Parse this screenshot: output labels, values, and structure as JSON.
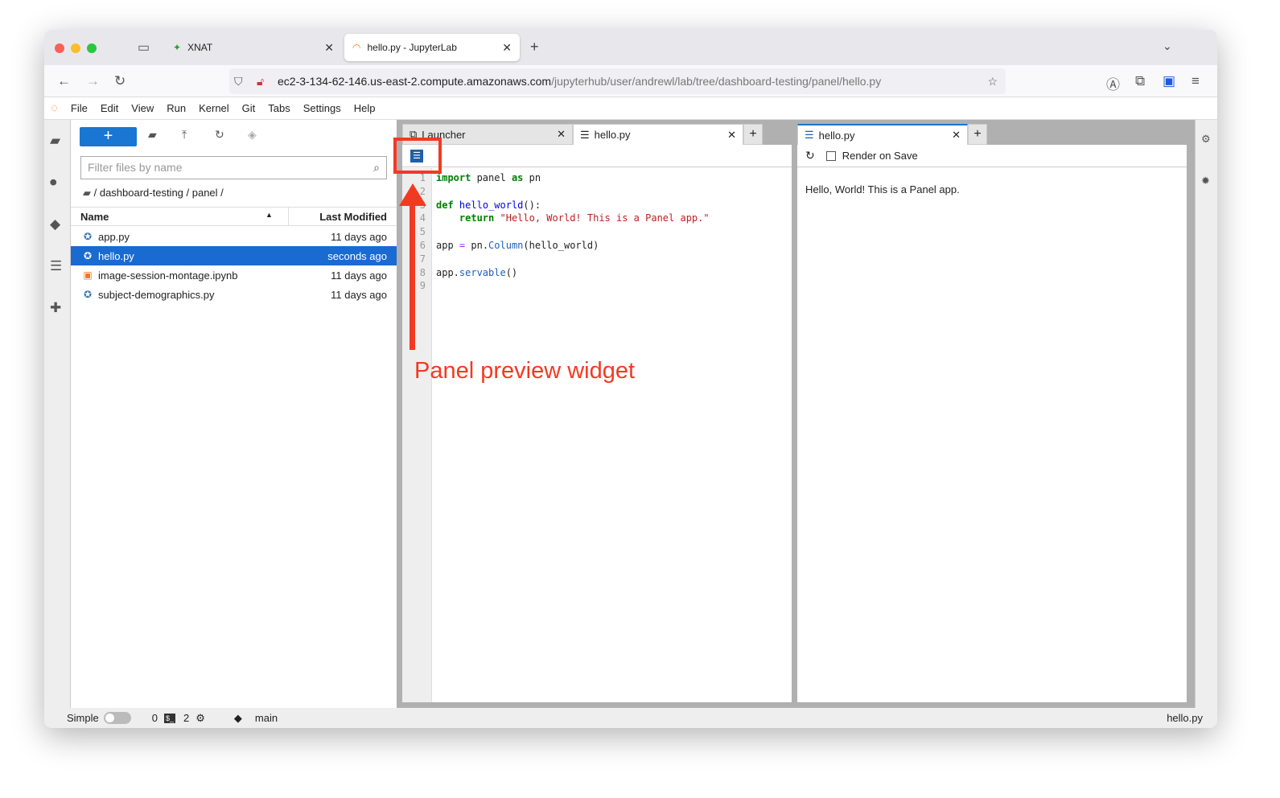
{
  "browser": {
    "tabs": [
      {
        "label": "XNAT",
        "close": "✕"
      },
      {
        "label": "hello.py - JupyterLab",
        "close": "✕"
      }
    ],
    "new_tab": "+",
    "url_host": "ec2-3-134-62-146.us-east-2.compute.amazonaws.com",
    "url_path": "/jupyterhub/user/andrewl/lab/tree/dashboard-testing/panel/hello.py"
  },
  "menu": [
    "File",
    "Edit",
    "View",
    "Run",
    "Kernel",
    "Git",
    "Tabs",
    "Settings",
    "Help"
  ],
  "filebrowser": {
    "new_label": "+",
    "filter_placeholder": "Filter files by name",
    "breadcrumb": "/ dashboard-testing / panel /",
    "col_name": "Name",
    "col_modified": "Last Modified",
    "files": [
      {
        "name": "app.py",
        "modified": "11 days ago",
        "type": "python"
      },
      {
        "name": "hello.py",
        "modified": "seconds ago",
        "type": "python"
      },
      {
        "name": "image-session-montage.ipynb",
        "modified": "11 days ago",
        "type": "notebook"
      },
      {
        "name": "subject-demographics.py",
        "modified": "11 days ago",
        "type": "python"
      }
    ]
  },
  "editor": {
    "tabs": [
      {
        "label": "Launcher",
        "close": "✕"
      },
      {
        "label": "hello.py",
        "close": "✕"
      }
    ],
    "add": "+",
    "line_numbers": [
      "1",
      "2",
      "3",
      "4",
      "5",
      "6",
      "7",
      "8",
      "9"
    ]
  },
  "preview": {
    "tab": "hello.py",
    "close": "✕",
    "add": "+",
    "render_on_save": "Render on Save",
    "render_checked": false,
    "output": "Hello, World! This is a Panel app."
  },
  "status": {
    "mode": "Simple",
    "terminals": "0",
    "kernels": "2",
    "branch": "main",
    "file": "hello.py"
  },
  "annotation": "Panel preview widget",
  "colors": {
    "accent": "#1976d2",
    "annotation": "#f23a22"
  }
}
